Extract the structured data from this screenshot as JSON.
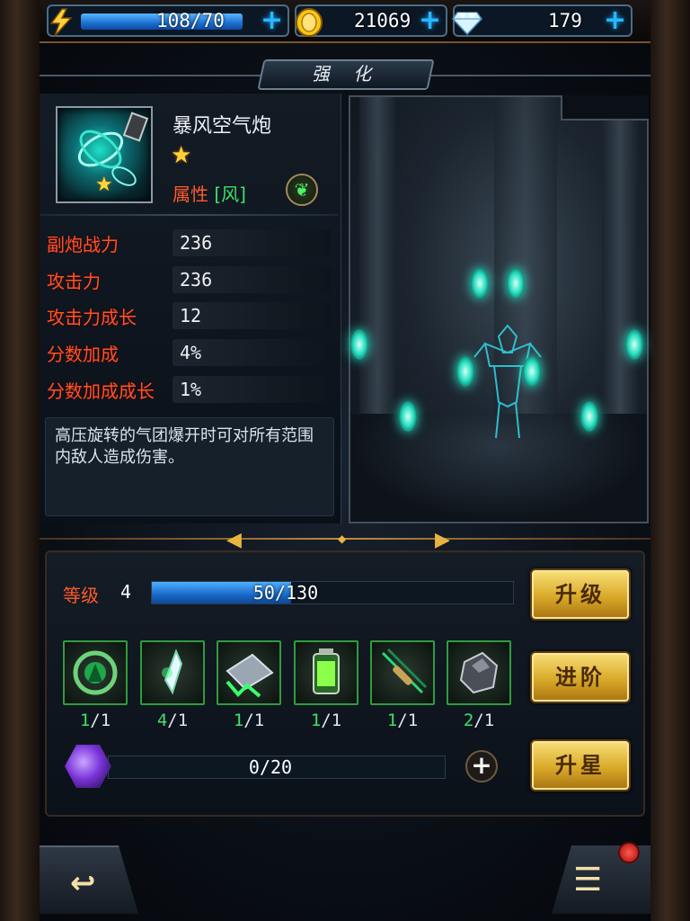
{
  "resources": {
    "energy": {
      "value": "108/70",
      "fill_fraction": 1.0
    },
    "gold": {
      "value": "21069"
    },
    "gems": {
      "value": "179"
    }
  },
  "title": "强 化",
  "weapon": {
    "name": "暴风空气炮",
    "stars": "★",
    "attr_label": "属性",
    "attr_value": "[风]",
    "element_icon": "wind-leaf-icon"
  },
  "stats": [
    {
      "label": "副炮战力",
      "value": "236"
    },
    {
      "label": "攻击力",
      "value": "236"
    },
    {
      "label": "攻击力成长",
      "value": "12"
    },
    {
      "label": "分数加成",
      "value": "4%"
    },
    {
      "label": "分数加成成长",
      "value": "1%"
    }
  ],
  "description": "高压旋转的气团爆开时可对所有范围内敌人造成伤害。",
  "level": {
    "label": "等级",
    "value": "4",
    "exp_text": "50/130",
    "exp_fraction": 0.3846
  },
  "materials": [
    {
      "icon": "ring-core-icon",
      "have": "1",
      "need": "1"
    },
    {
      "icon": "crystal-shard-icon",
      "have": "4",
      "need": "1"
    },
    {
      "icon": "metal-plate-icon",
      "have": "1",
      "need": "1"
    },
    {
      "icon": "energy-canister-icon",
      "have": "1",
      "need": "1"
    },
    {
      "icon": "bullet-icon",
      "have": "1",
      "need": "1"
    },
    {
      "icon": "ore-chunk-icon",
      "have": "2",
      "need": "1"
    }
  ],
  "fragments": {
    "text": "0/20",
    "fraction": 0
  },
  "buttons": {
    "upgrade": "升级",
    "advance": "进阶",
    "star_up": "升星"
  },
  "colors": {
    "stat_label": "#ff5226",
    "attr_value": "#3fe06a",
    "button_gold": "#d9a928",
    "exp_blue": "#1868c8"
  }
}
